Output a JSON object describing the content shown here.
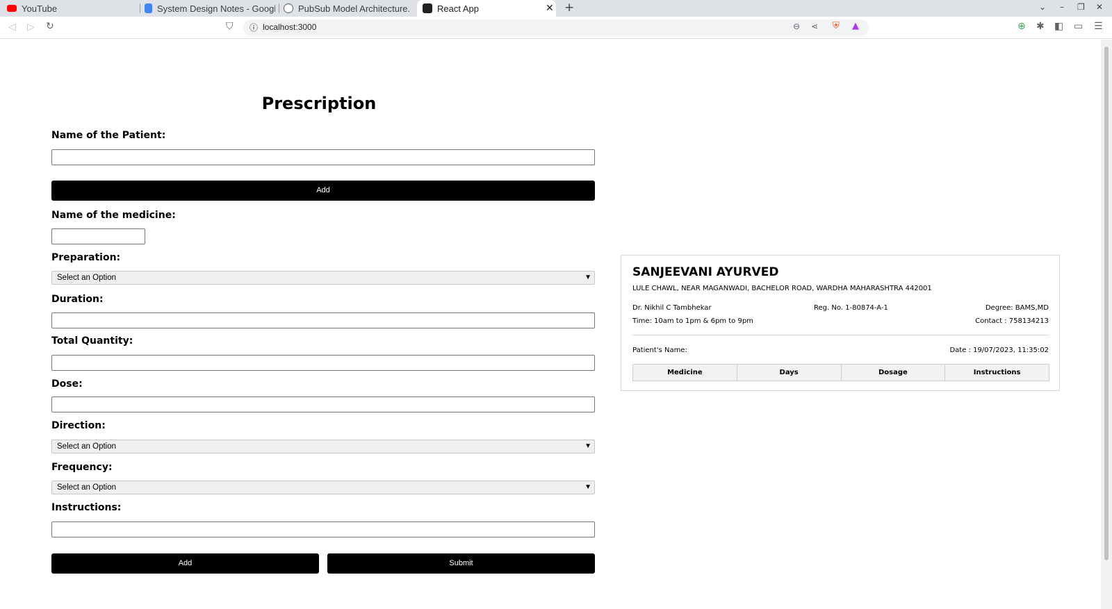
{
  "browser": {
    "tabs": [
      {
        "title": "YouTube"
      },
      {
        "title": "System Design Notes - Google"
      },
      {
        "title": "PubSub Model Architecture."
      },
      {
        "title": "React App"
      }
    ],
    "url": "localhost:3000",
    "colors": {
      "tabbar": "#dee1e6",
      "youtube": "#ff0000",
      "docs": "#4285f4"
    }
  },
  "form": {
    "title": "Prescription",
    "patient_label": "Name of the Patient:",
    "patient_value": "",
    "add_patient_button": "Add",
    "medicine_label": "Name of the medicine:",
    "medicine_value": "",
    "preparation_label": "Preparation:",
    "preparation_selected": "Select an Option",
    "duration_label": "Duration:",
    "duration_value": "",
    "quantity_label": "Total Quantity:",
    "quantity_value": "",
    "dose_label": "Dose:",
    "dose_value": "",
    "direction_label": "Direction:",
    "direction_selected": "Select an Option",
    "frequency_label": "Frequency:",
    "frequency_selected": "Select an Option",
    "instructions_label": "Instructions:",
    "instructions_value": "",
    "add_button": "Add",
    "submit_button": "Submit"
  },
  "card": {
    "clinic_name": "SANJEEVANI AYURVED",
    "address": "LULE CHAWL, NEAR MAGANWADI, BACHELOR ROAD, WARDHA MAHARASHTRA 442001",
    "doctor": "Dr. Nikhil C Tambhekar",
    "reg_no": "Reg. No. 1-80874-A-1",
    "degree": "Degree: BAMS,MD",
    "time": "Time: 10am to 1pm & 6pm to 9pm",
    "contact": "Contact : 758134213",
    "patient_name_label": "Patient's Name:",
    "date": "Date : 19/07/2023, 11:35:02",
    "table_headers": [
      "Medicine",
      "Days",
      "Dosage",
      "Instructions"
    ]
  }
}
